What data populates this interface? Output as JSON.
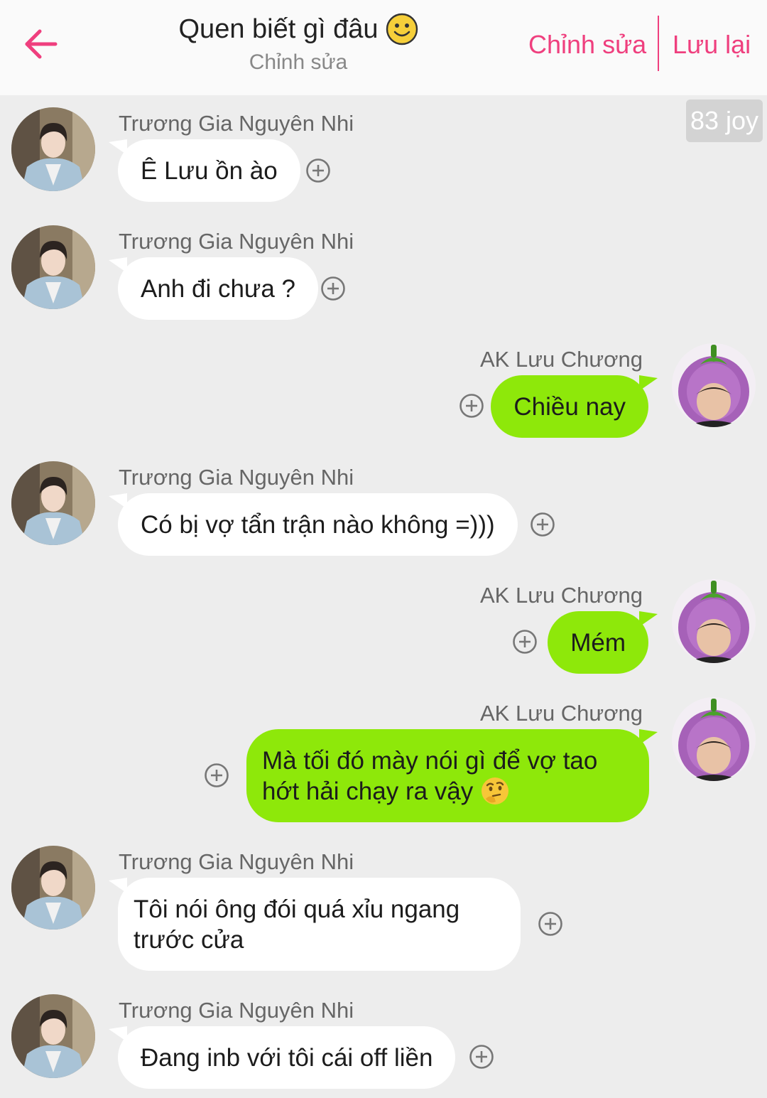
{
  "header": {
    "back_icon": "arrow-left-icon",
    "title": "Quen biết gì đâu",
    "subtitle": "Chỉnh sửa",
    "edit_label": "Chỉnh sửa",
    "save_label": "Lưu lại",
    "accent_color": "#ef3f7e"
  },
  "joy_badge": "83 joy",
  "messages": [
    {
      "side": "left",
      "sender": "Trương Gia Nguyên Nhi",
      "text": "Ê Lưu ồn ào"
    },
    {
      "side": "left",
      "sender": "Trương Gia Nguyên Nhi",
      "text": "Anh đi chưa ?"
    },
    {
      "side": "right",
      "sender": "AK Lưu Chương",
      "text": "Chiều nay"
    },
    {
      "side": "left",
      "sender": "Trương Gia Nguyên Nhi",
      "text": "Có bị vợ tẩn trận nào không =)))"
    },
    {
      "side": "right",
      "sender": "AK Lưu Chương",
      "text": "Mém"
    },
    {
      "side": "right",
      "sender": "AK Lưu Chương",
      "line1": "Mà tối đó mày nói gì để vợ tao",
      "line2": "hớt hải chạy ra vậy"
    },
    {
      "side": "left",
      "sender": "Trương Gia Nguyên Nhi",
      "line1": "Tôi nói ông đói quá xỉu ngang",
      "line2": "trước cửa"
    },
    {
      "side": "left",
      "sender": "Trương Gia Nguyên Nhi",
      "text": "Đang inb với tôi cái off liền"
    }
  ],
  "colors": {
    "left_bubble": "#ffffff",
    "right_bubble": "#8ee80a",
    "background": "#ededed"
  }
}
